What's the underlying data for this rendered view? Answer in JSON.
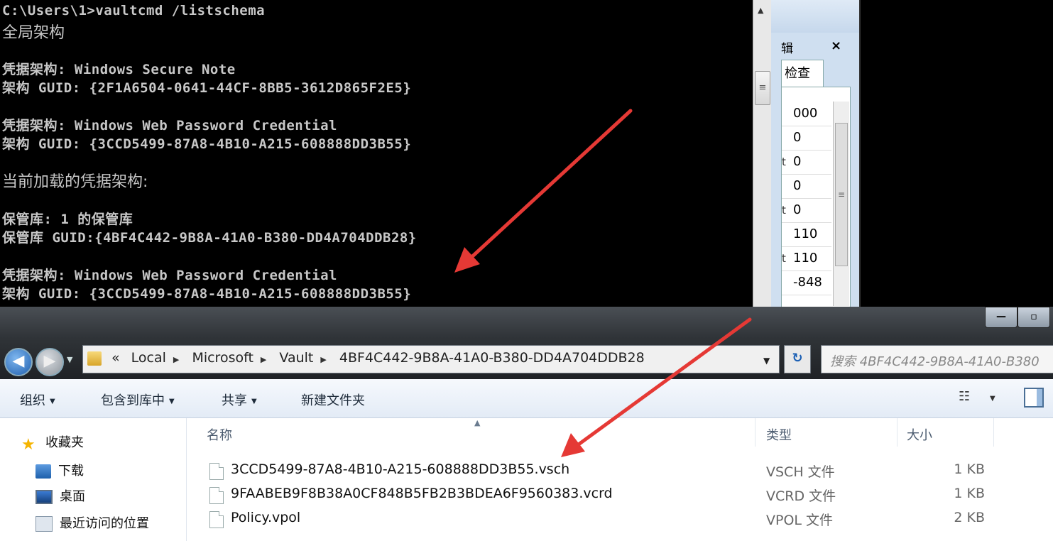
{
  "console": {
    "lines": [
      "C:\\Users\\1>vaultcmd /listschema",
      "全局架构",
      "凭据架构: Windows Secure Note",
      "架构 GUID: {2F1A6504-0641-44CF-8BB5-3612D865F2E5}",
      "凭据架构: Windows Web Password Credential",
      "架构 GUID: {3CCD5499-87A8-4B10-A215-608888DD3B55}",
      "当前加载的凭据架构:",
      "保管库: 1 的保管库",
      "保管库 GUID:{4BF4C442-9B8A-41A0-B380-DD4A704DDB28}",
      "凭据架构: Windows Web Password Credential",
      "架构 GUID: {3CCD5499-87A8-4B10-A215-608888DD3B55}"
    ]
  },
  "bg_dialog": {
    "edit_label": "辑",
    "close_label": "×",
    "tab_label": "检查",
    "rows": [
      {
        "key": "",
        "value": "000"
      },
      {
        "key": "",
        "value": "0"
      },
      {
        "key": "t",
        "value": "0"
      },
      {
        "key": "",
        "value": "0"
      },
      {
        "key": "t",
        "value": "0"
      },
      {
        "key": "",
        "value": "110"
      },
      {
        "key": "t",
        "value": "110"
      },
      {
        "key": "",
        "value": "-848"
      }
    ]
  },
  "explorer": {
    "window_buttons": {
      "minimize": "—",
      "maximize": "▫"
    },
    "breadcrumb": {
      "overflow": "«",
      "items": [
        "Local",
        "Microsoft",
        "Vault",
        "4BF4C442-9B8A-41A0-B380-DD4A704DDB28"
      ]
    },
    "search_placeholder": "搜索 4BF4C442-9B8A-41A0-B380",
    "toolbar": {
      "organize": "组织",
      "include_in_library": "包含到库中",
      "share": "共享",
      "new_folder": "新建文件夹"
    },
    "nav": {
      "favorites": "收藏夹",
      "downloads": "下载",
      "desktop": "桌面",
      "recent": "最近访问的位置"
    },
    "columns": {
      "name": "名称",
      "type": "类型",
      "size": "大小"
    },
    "files": [
      {
        "name": "3CCD5499-87A8-4B10-A215-608888DD3B55.vsch",
        "type": "VSCH 文件",
        "size": "1 KB"
      },
      {
        "name": "9FAABEB9F8B38A0CF848B5FB2B3BDEA6F9560383.vcrd",
        "type": "VCRD 文件",
        "size": "1 KB"
      },
      {
        "name": "Policy.vpol",
        "type": "VPOL 文件",
        "size": "2 KB"
      }
    ]
  },
  "colors": {
    "console_bg": "#000000",
    "console_text": "#c8c8c8",
    "annotation_arrow": "#e53935"
  }
}
